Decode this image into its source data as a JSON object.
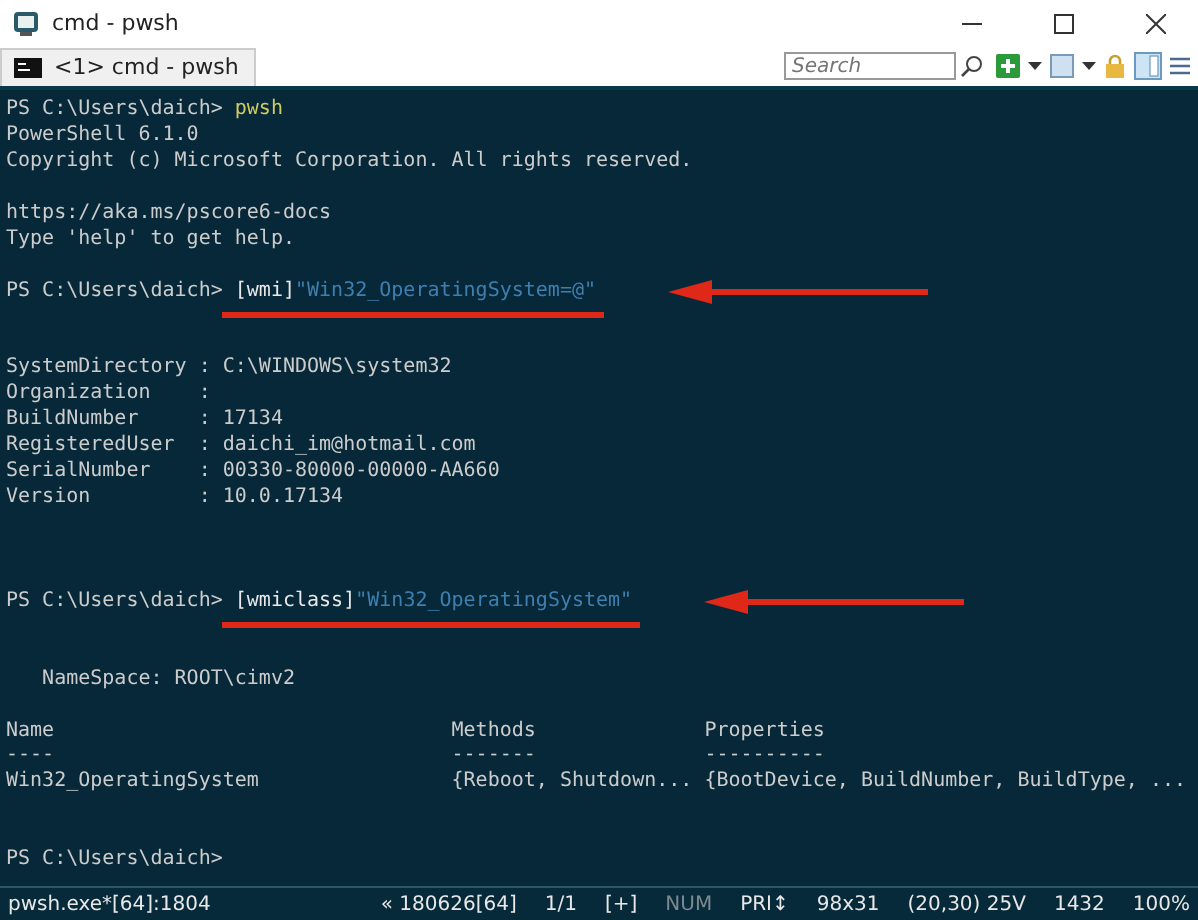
{
  "window": {
    "title": "cmd - pwsh"
  },
  "tabs": [
    {
      "label": "<1> cmd - pwsh",
      "selected": true
    }
  ],
  "search": {
    "placeholder": "Search"
  },
  "terminal": {
    "lines": [
      {
        "kind": "line",
        "segments": [
          {
            "kind": "text",
            "text": "PS C:\\Users\\daich> "
          },
          {
            "kind": "command",
            "text": "pwsh"
          }
        ]
      },
      {
        "kind": "line",
        "segments": [
          {
            "kind": "text",
            "text": "PowerShell 6.1.0"
          }
        ]
      },
      {
        "kind": "line",
        "segments": [
          {
            "kind": "text",
            "text": "Copyright (c) Microsoft Corporation. All rights reserved."
          }
        ]
      },
      {
        "kind": "blank"
      },
      {
        "kind": "line",
        "segments": [
          {
            "kind": "text",
            "text": "https://aka.ms/pscore6-docs"
          }
        ]
      },
      {
        "kind": "line",
        "segments": [
          {
            "kind": "text",
            "text": "Type 'help' to get help."
          }
        ]
      },
      {
        "kind": "blank"
      },
      {
        "kind": "line",
        "marked": true,
        "segments": [
          {
            "kind": "text",
            "text": "PS C:\\Users\\daich> "
          },
          {
            "kind": "type",
            "text": "[wmi]"
          },
          {
            "kind": "string",
            "text": "\"Win32_OperatingSystem=@\""
          }
        ]
      },
      {
        "kind": "blank"
      },
      {
        "kind": "blank"
      },
      {
        "kind": "line",
        "segments": [
          {
            "kind": "text",
            "text": "SystemDirectory : C:\\WINDOWS\\system32"
          }
        ]
      },
      {
        "kind": "line",
        "segments": [
          {
            "kind": "text",
            "text": "Organization    :"
          }
        ]
      },
      {
        "kind": "line",
        "segments": [
          {
            "kind": "text",
            "text": "BuildNumber     : 17134"
          }
        ]
      },
      {
        "kind": "line",
        "segments": [
          {
            "kind": "text",
            "text": "RegisteredUser  : daichi_im@hotmail.com"
          }
        ]
      },
      {
        "kind": "line",
        "segments": [
          {
            "kind": "text",
            "text": "SerialNumber    : 00330-80000-00000-AA660"
          }
        ]
      },
      {
        "kind": "line",
        "segments": [
          {
            "kind": "text",
            "text": "Version         : 10.0.17134"
          }
        ]
      },
      {
        "kind": "blank"
      },
      {
        "kind": "blank"
      },
      {
        "kind": "blank"
      },
      {
        "kind": "line",
        "marked": true,
        "segments": [
          {
            "kind": "text",
            "text": "PS C:\\Users\\daich> "
          },
          {
            "kind": "type",
            "text": "[wmiclass]"
          },
          {
            "kind": "string",
            "text": "\"Win32_OperatingSystem\""
          }
        ]
      },
      {
        "kind": "blank"
      },
      {
        "kind": "blank"
      },
      {
        "kind": "line",
        "segments": [
          {
            "kind": "text",
            "text": "   NameSpace: ROOT\\cimv2"
          }
        ]
      },
      {
        "kind": "blank"
      },
      {
        "kind": "line",
        "segments": [
          {
            "kind": "text",
            "text": "Name                                 Methods              Properties"
          }
        ]
      },
      {
        "kind": "line",
        "segments": [
          {
            "kind": "text",
            "text": "----                                 -------              ----------"
          }
        ]
      },
      {
        "kind": "line",
        "segments": [
          {
            "kind": "text",
            "text": "Win32_OperatingSystem                {Reboot, Shutdown... {BootDevice, BuildNumber, BuildType, ..."
          }
        ]
      },
      {
        "kind": "blank"
      },
      {
        "kind": "blank"
      },
      {
        "kind": "line",
        "segments": [
          {
            "kind": "text",
            "text": "PS C:\\Users\\daich>"
          }
        ]
      }
    ]
  },
  "status_bar": [
    "pwsh.exe*[64]:1804",
    "« 180626[64]",
    "1/1",
    "[+]",
    "NUM",
    "PRI↕",
    "98x31",
    "(20,30) 25V",
    "1432",
    "100%"
  ]
}
